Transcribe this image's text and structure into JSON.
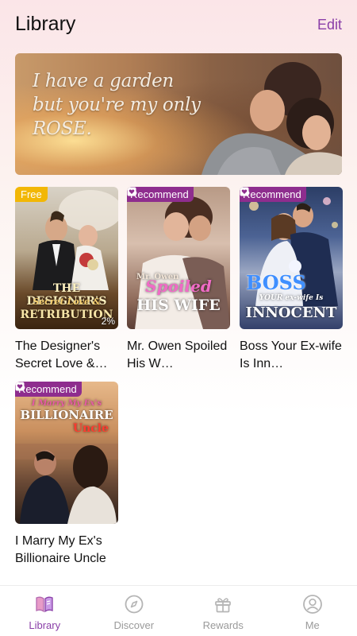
{
  "header": {
    "title": "Library",
    "edit_label": "Edit"
  },
  "banner": {
    "lines": [
      "I have a garden",
      "but you're my only",
      "ROSE."
    ]
  },
  "books": [
    {
      "title": "The Designer's Secret Love &…",
      "badge": "Free",
      "badge_type": "free",
      "progress": "2%",
      "cover_text": [
        "THE DESIGNER'S",
        "Secret Love &",
        "RETRIBUTION"
      ]
    },
    {
      "title": "Mr. Owen Spoiled His W…",
      "badge": "Recommend",
      "badge_type": "recommend",
      "cover_text": [
        "Mr. Owen",
        "Spoiled",
        "HIS WIFE"
      ]
    },
    {
      "title": "Boss Your Ex-wife Is Inn…",
      "badge": "Recommend",
      "badge_type": "recommend",
      "cover_text": [
        "BOSS",
        "YOUR ex-wife Is",
        "INNOCENT"
      ]
    },
    {
      "title": "I Marry My Ex's Billionaire Uncle",
      "badge": "Recommend",
      "badge_type": "recommend",
      "cover_text": [
        "I Marry My Ex's",
        "BILLIONAIRE",
        "Uncle"
      ]
    }
  ],
  "tabs": [
    {
      "label": "Library",
      "icon": "book-icon",
      "active": true
    },
    {
      "label": "Discover",
      "icon": "compass-icon",
      "active": false
    },
    {
      "label": "Rewards",
      "icon": "gift-icon",
      "active": false
    },
    {
      "label": "Me",
      "icon": "user-icon",
      "active": false
    }
  ],
  "colors": {
    "accent": "#8a3fa8",
    "badge_free": "#f2b705",
    "badge_recommend": "#8e2d8e",
    "tab_inactive": "#9a9a9a"
  }
}
